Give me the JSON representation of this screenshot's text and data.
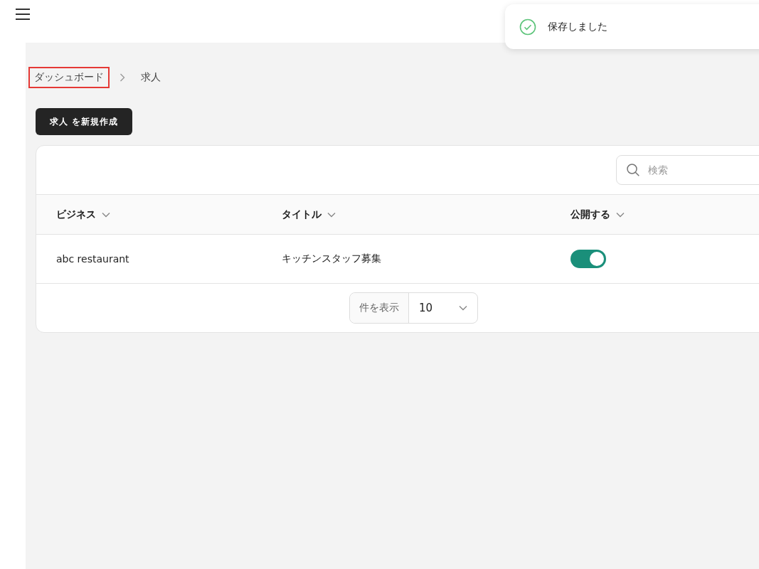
{
  "toast": {
    "message": "保存しました"
  },
  "breadcrumb": [
    {
      "label": "ダッシュボード",
      "highlighted": true
    },
    {
      "label": "求人",
      "highlighted": false
    }
  ],
  "create_button": "求人 を新規作成",
  "search": {
    "placeholder": "検索"
  },
  "table": {
    "columns": [
      "ビジネス",
      "タイトル",
      "公開する"
    ],
    "rows": [
      {
        "business": "abc restaurant",
        "title": "キッチンスタッフ募集",
        "published": true
      }
    ]
  },
  "pagination": {
    "label": "件を表示",
    "per_page": "10"
  }
}
